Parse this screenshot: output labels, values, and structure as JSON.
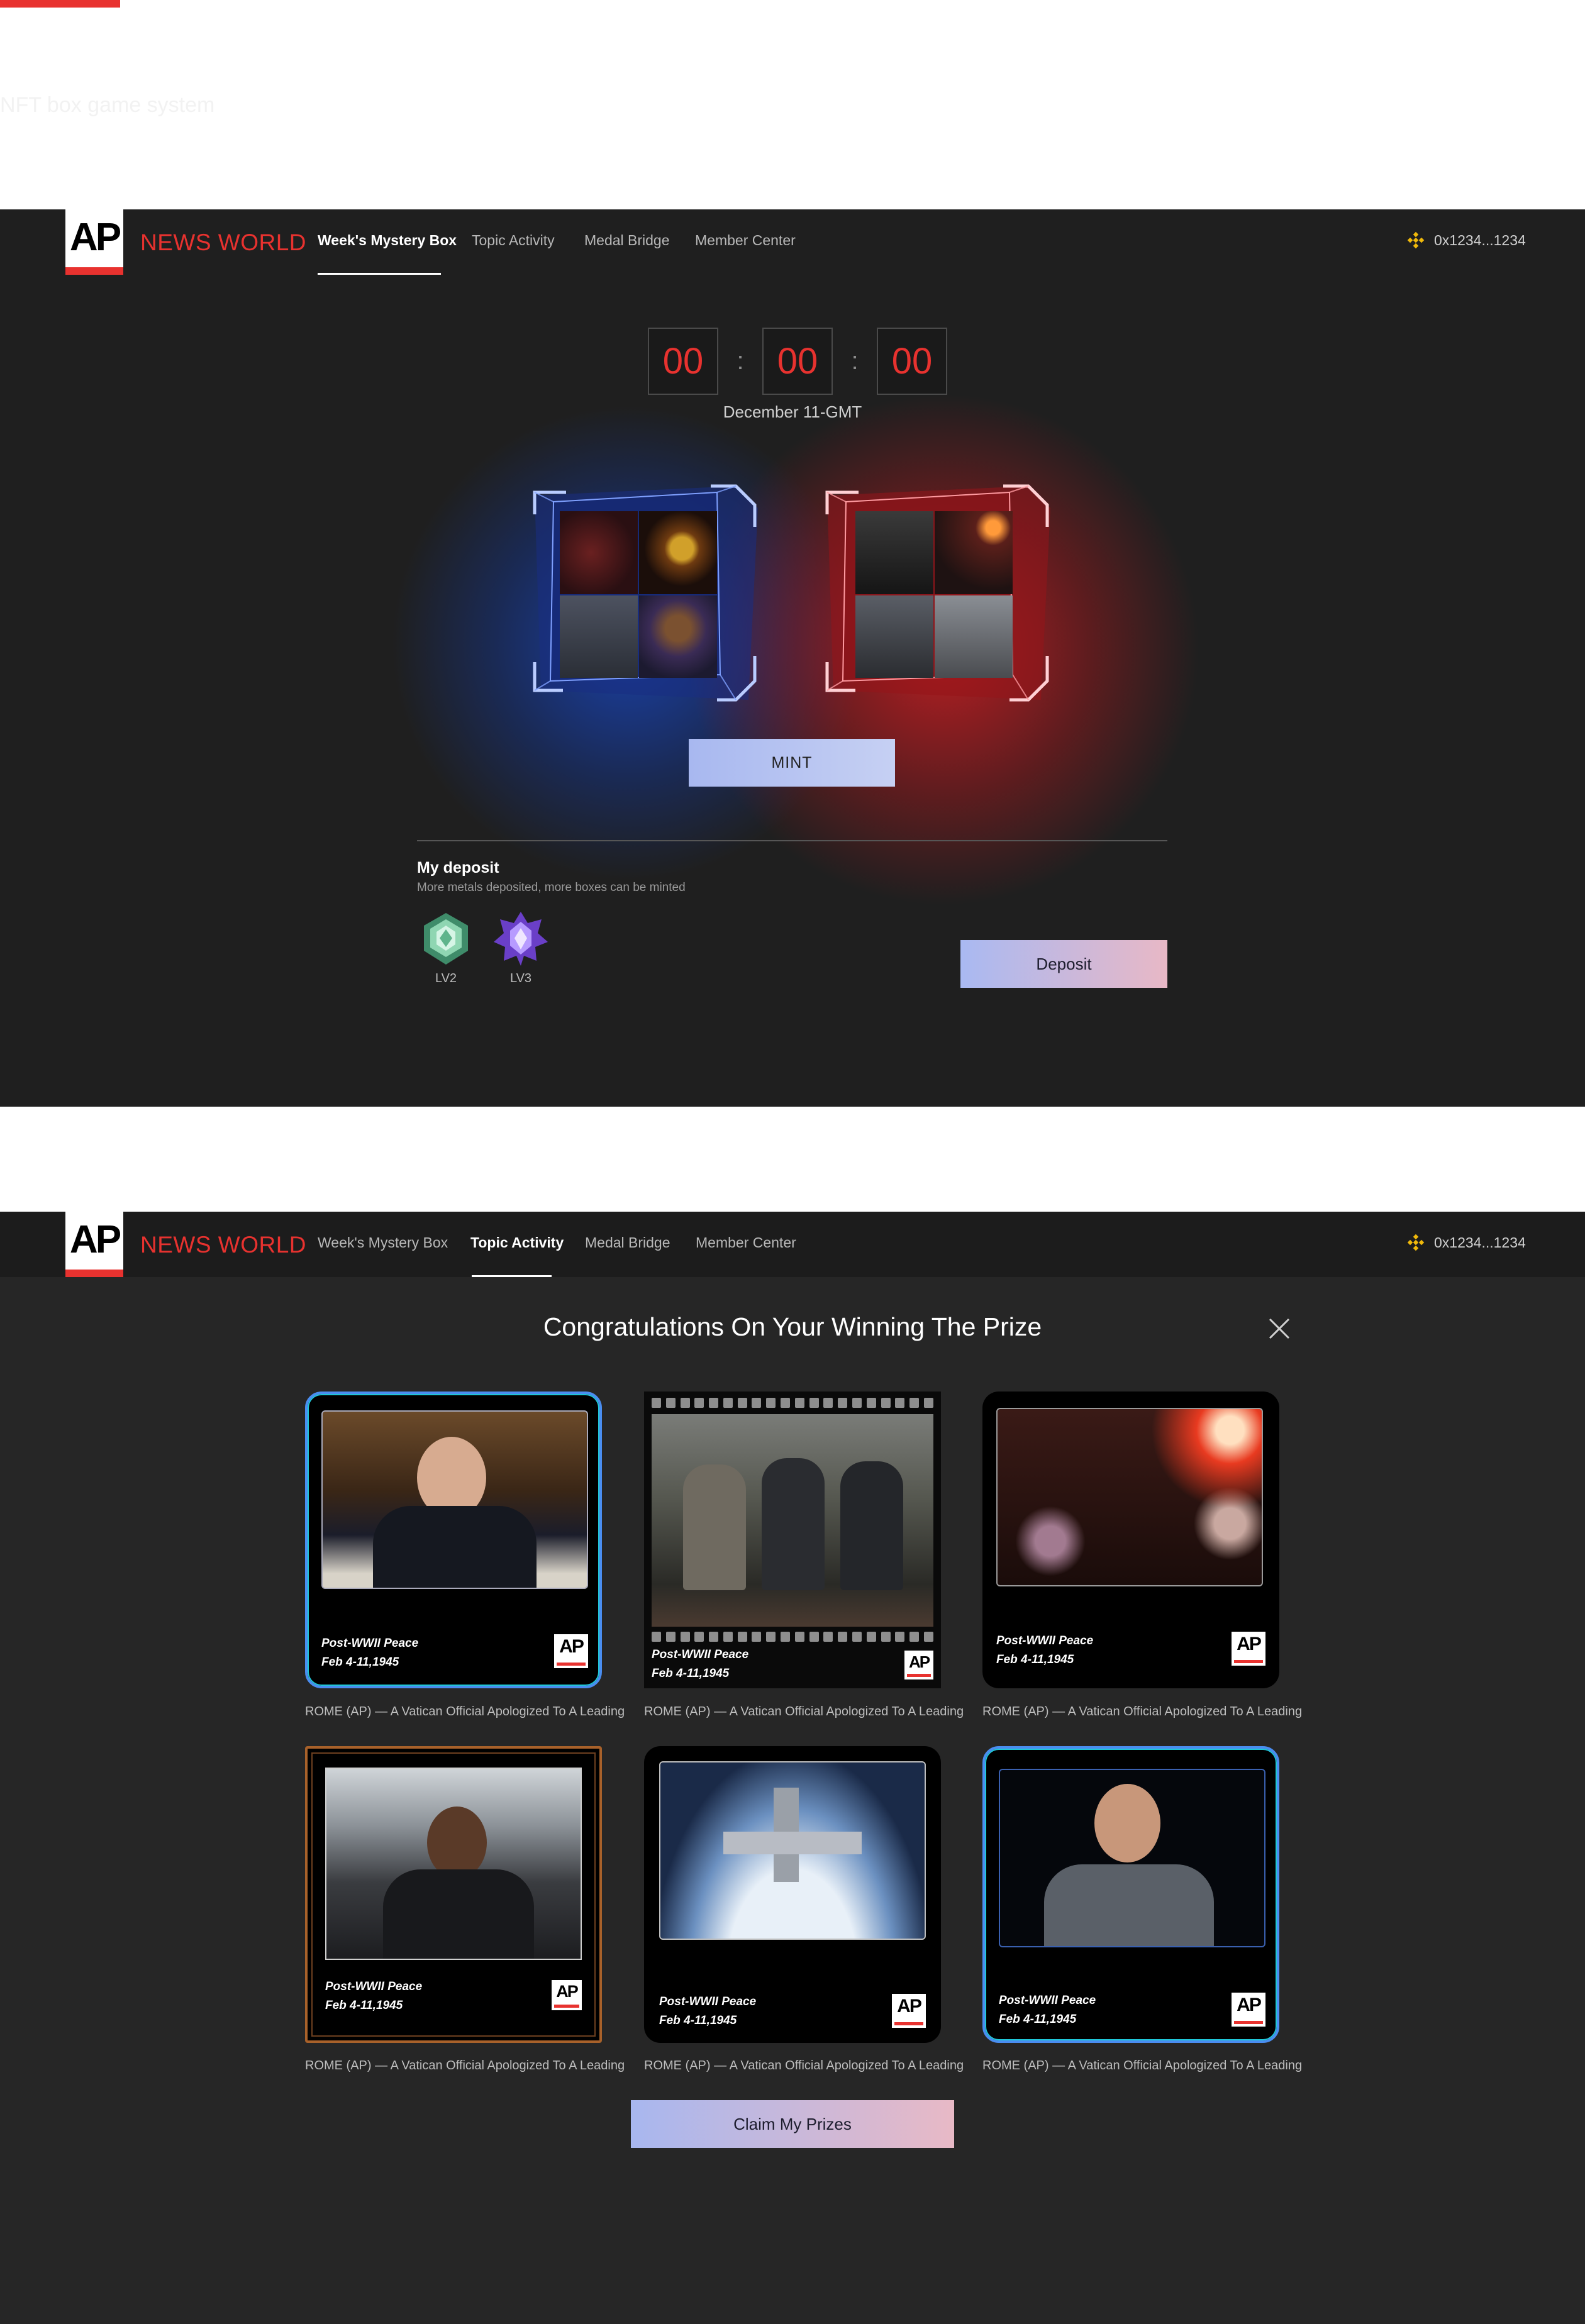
{
  "page": {
    "caption": "NFT box game system"
  },
  "colors": {
    "accent_red": "#e8322f",
    "binance_yellow": "#f0b90b"
  },
  "nav": {
    "brand": "NEWS WORLD",
    "logo_text": "AP",
    "items": [
      "Week's Mystery Box",
      "Topic Activity",
      "Medal Bridge",
      "Member Center"
    ],
    "wallet": "0x1234...1234",
    "wallet_icon": "binance-icon"
  },
  "mystery": {
    "countdown": {
      "hours": "00",
      "minutes": "00",
      "seconds": "00",
      "separator": ":"
    },
    "date": "December 11-GMT",
    "mint_label": "MINT",
    "deposit": {
      "title": "My deposit",
      "subtitle": "More metals deposited, more boxes can be minted",
      "medals": [
        {
          "label": "LV2",
          "icon": "green-medal-icon"
        },
        {
          "label": "LV3",
          "icon": "purple-medal-icon"
        }
      ],
      "button": "Deposit"
    }
  },
  "prize": {
    "title": "Congratulations On Your Winning The Prize",
    "cards": [
      {
        "line1": "Post-WWII Peace",
        "line2": "Feb 4-11,1945",
        "caption": "ROME (AP) — A Vatican Official Apologized To A Leading",
        "badge": "AP"
      },
      {
        "line1": "Post-WWII Peace",
        "line2": "Feb 4-11,1945",
        "caption": "ROME (AP) — A Vatican Official Apologized To A Leading",
        "badge": "AP"
      },
      {
        "line1": "Post-WWII Peace",
        "line2": "Feb 4-11,1945",
        "caption": "ROME (AP) — A Vatican Official Apologized To A Leading",
        "badge": "AP"
      },
      {
        "line1": "Post-WWII Peace",
        "line2": "Feb 4-11,1945",
        "caption": "ROME (AP) — A Vatican Official Apologized To A Leading",
        "badge": "AP"
      },
      {
        "line1": "Post-WWII Peace",
        "line2": "Feb 4-11,1945",
        "caption": "ROME (AP) — A Vatican Official Apologized To A Leading",
        "badge": "AP"
      },
      {
        "line1": "Post-WWII Peace",
        "line2": "Feb 4-11,1945",
        "caption": "ROME (AP) — A Vatican Official Apologized To A Leading",
        "badge": "AP"
      }
    ],
    "claim_label": "Claim My Prizes"
  }
}
